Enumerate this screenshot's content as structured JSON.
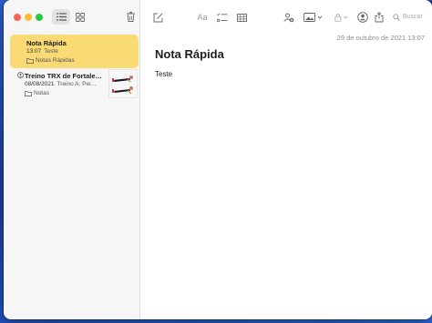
{
  "sidebar": {
    "notes": [
      {
        "title": "Nota Rápida",
        "time": "13:07",
        "preview": "Teste",
        "folder": "Notas Rápidas",
        "selected": true
      },
      {
        "title": "Treino TRX de Fortale…",
        "time": "08/08/2021",
        "preview": "Treino A: Pei…",
        "folder": "Notas",
        "shared": true
      }
    ]
  },
  "toolbar": {
    "format_label": "Aa",
    "search_placeholder": "Buscar"
  },
  "note": {
    "date": "29 de outubro de 2021 13:07",
    "title": "Nota Rápida",
    "body": "Teste"
  },
  "colors": {
    "selection": "#f9da74",
    "close": "#fe5f57",
    "minimize": "#febc2e",
    "zoom": "#28c840"
  },
  "icons": [
    "list-view-icon",
    "gallery-view-icon",
    "trash-icon",
    "compose-icon",
    "checklist-icon",
    "table-icon",
    "add-people-icon",
    "media-icon",
    "lock-icon",
    "collaboration-icon",
    "share-icon",
    "search-icon",
    "folder-icon"
  ]
}
